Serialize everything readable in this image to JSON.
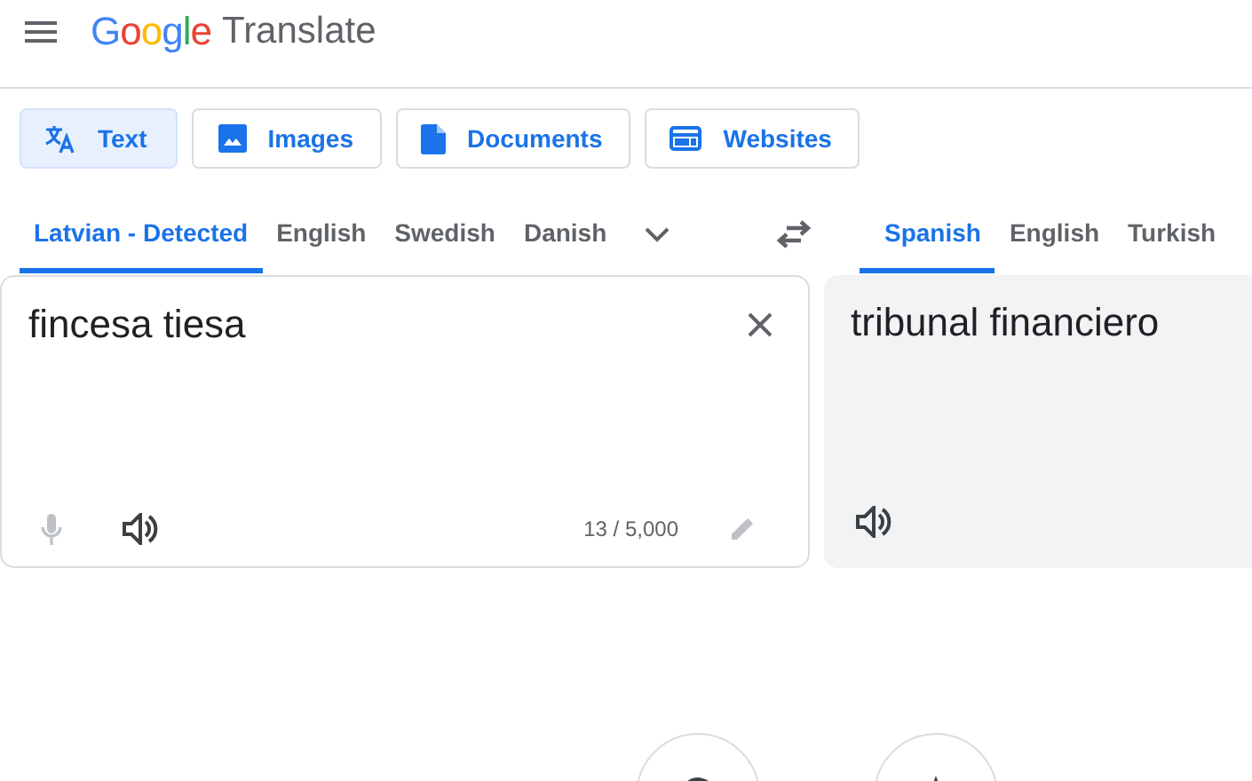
{
  "header": {
    "logo": "Google",
    "product": "Translate"
  },
  "modes": [
    {
      "kind": "text",
      "label": "Text",
      "selected": true
    },
    {
      "kind": "images",
      "label": "Images",
      "selected": false
    },
    {
      "kind": "documents",
      "label": "Documents",
      "selected": false
    },
    {
      "kind": "websites",
      "label": "Websites",
      "selected": false
    }
  ],
  "source_languages": [
    {
      "label": "Latvian - Detected",
      "selected": true
    },
    {
      "label": "English",
      "selected": false
    },
    {
      "label": "Swedish",
      "selected": false
    },
    {
      "label": "Danish",
      "selected": false
    }
  ],
  "target_languages": [
    {
      "label": "Spanish",
      "selected": true
    },
    {
      "label": "English",
      "selected": false
    },
    {
      "label": "Turkish",
      "selected": false
    }
  ],
  "source": {
    "value": "fincesa tiesa",
    "counter": "13 / 5,000",
    "microphone_disabled": true,
    "edit_disabled": true
  },
  "target": {
    "text": "tribunal financiero"
  },
  "bottom_buttons": [
    {
      "kind": "history"
    },
    {
      "kind": "saved"
    }
  ]
}
